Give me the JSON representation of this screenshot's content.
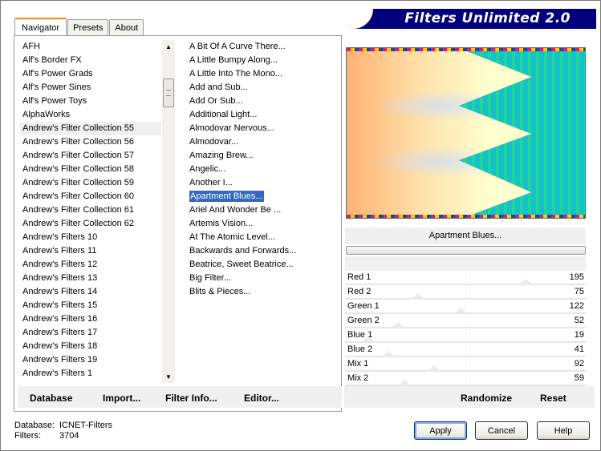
{
  "window": {
    "title": "Filters Unlimited 2.0"
  },
  "tabs": [
    {
      "label": "Navigator",
      "active": true
    },
    {
      "label": "Presets",
      "active": false
    },
    {
      "label": "About",
      "active": false
    }
  ],
  "categories": [
    "AFH",
    "Alf's Border FX",
    "Alf's Power Grads",
    "Alf's Power Sines",
    "Alf's Power Toys",
    "AlphaWorks",
    "Andrew's Filter Collection 55",
    "Andrew's Filter Collection 56",
    "Andrew's Filter Collection 57",
    "Andrew's Filter Collection 58",
    "Andrew's Filter Collection 59",
    "Andrew's Filter Collection 60",
    "Andrew's Filter Collection 61",
    "Andrew's Filter Collection 62",
    "Andrew's Filters 10",
    "Andrew's Filters 11",
    "Andrew's Filters 12",
    "Andrew's Filters 13",
    "Andrew's Filters 14",
    "Andrew's Filters 15",
    "Andrew's Filters 16",
    "Andrew's Filters 17",
    "Andrew's Filters 18",
    "Andrew's Filters 19",
    "Andrew's Filters 1"
  ],
  "selected_category": "Andrew's Filter Collection 55",
  "filters": [
    "A Bit Of A Curve There...",
    "A Little Bumpy Along...",
    "A Little Into The Mono...",
    "Add and Sub...",
    "Add Or Sub...",
    "Additional Light...",
    "Almodovar Nervous...",
    "Almodovar...",
    "Amazing Brew...",
    "Angelic...",
    "Another I...",
    "Apartment Blues...",
    "Ariel And Wonder Be ...",
    "Artemis Vision...",
    "At The Atomic Level...",
    "Backwards and Forwards...",
    "Beatrice, Sweet Beatrice...",
    "Big Filter...",
    "Blits & Pieces..."
  ],
  "selected_filter": "Apartment Blues...",
  "left_bar": {
    "database": "Database",
    "import": "Import...",
    "filter_info": "Filter Info...",
    "editor": "Editor..."
  },
  "current_filter_label": "Apartment Blues...",
  "parameters": [
    {
      "name": "Red 1",
      "value": "195",
      "level": 0.765
    },
    {
      "name": "Red 2",
      "value": "75",
      "level": 0.294
    },
    {
      "name": "Green 1",
      "value": "122",
      "level": 0.478
    },
    {
      "name": "Green 2",
      "value": "52",
      "level": 0.204
    },
    {
      "name": "Blue 1",
      "value": "19",
      "level": 0.075
    },
    {
      "name": "Blue 2",
      "value": "41",
      "level": 0.161
    },
    {
      "name": "Mix 1",
      "value": "92",
      "level": 0.361
    },
    {
      "name": "Mix 2",
      "value": "59",
      "level": 0.231
    }
  ],
  "right_bar": {
    "randomize": "Randomize",
    "reset": "Reset"
  },
  "status": {
    "database_label": "Database:",
    "database_value": "ICNET-Filters",
    "filters_label": "Filters:",
    "filters_value": "3704"
  },
  "buttons": {
    "apply": "Apply",
    "cancel": "Cancel",
    "help": "Help"
  }
}
